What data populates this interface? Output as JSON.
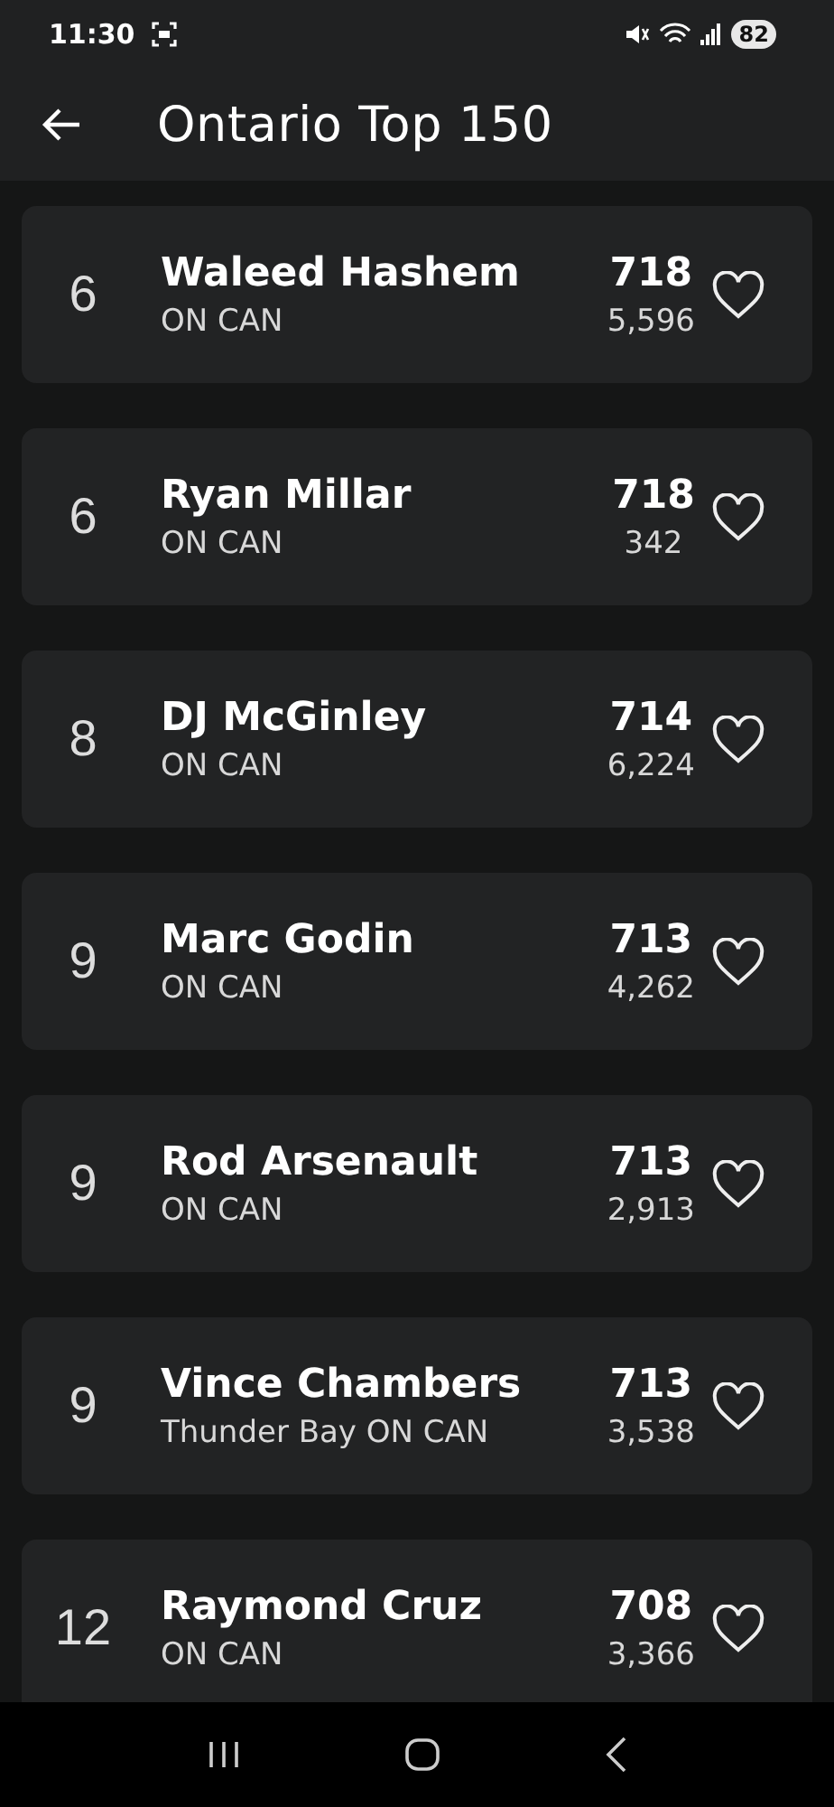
{
  "status_bar": {
    "time": "11:30",
    "battery": "82"
  },
  "header": {
    "title": "Ontario Top 150"
  },
  "players": [
    {
      "rank": "6",
      "name": "Waleed Hashem",
      "location": "ON CAN",
      "score": "718",
      "count": "5,596",
      "favorite": false
    },
    {
      "rank": "6",
      "name": "Ryan Millar",
      "location": "ON CAN",
      "score": "718",
      "count": "342",
      "favorite": false
    },
    {
      "rank": "8",
      "name": "DJ McGinley",
      "location": "ON CAN",
      "score": "714",
      "count": "6,224",
      "favorite": false
    },
    {
      "rank": "9",
      "name": "Marc Godin",
      "location": "ON CAN",
      "score": "713",
      "count": "4,262",
      "favorite": false
    },
    {
      "rank": "9",
      "name": "Rod Arsenault",
      "location": "ON CAN",
      "score": "713",
      "count": "2,913",
      "favorite": false
    },
    {
      "rank": "9",
      "name": "Vince Chambers",
      "location": "Thunder Bay ON CAN",
      "score": "713",
      "count": "3,538",
      "favorite": false
    },
    {
      "rank": "12",
      "name": "Raymond Cruz",
      "location": "ON CAN",
      "score": "708",
      "count": "3,366",
      "favorite": false
    }
  ]
}
